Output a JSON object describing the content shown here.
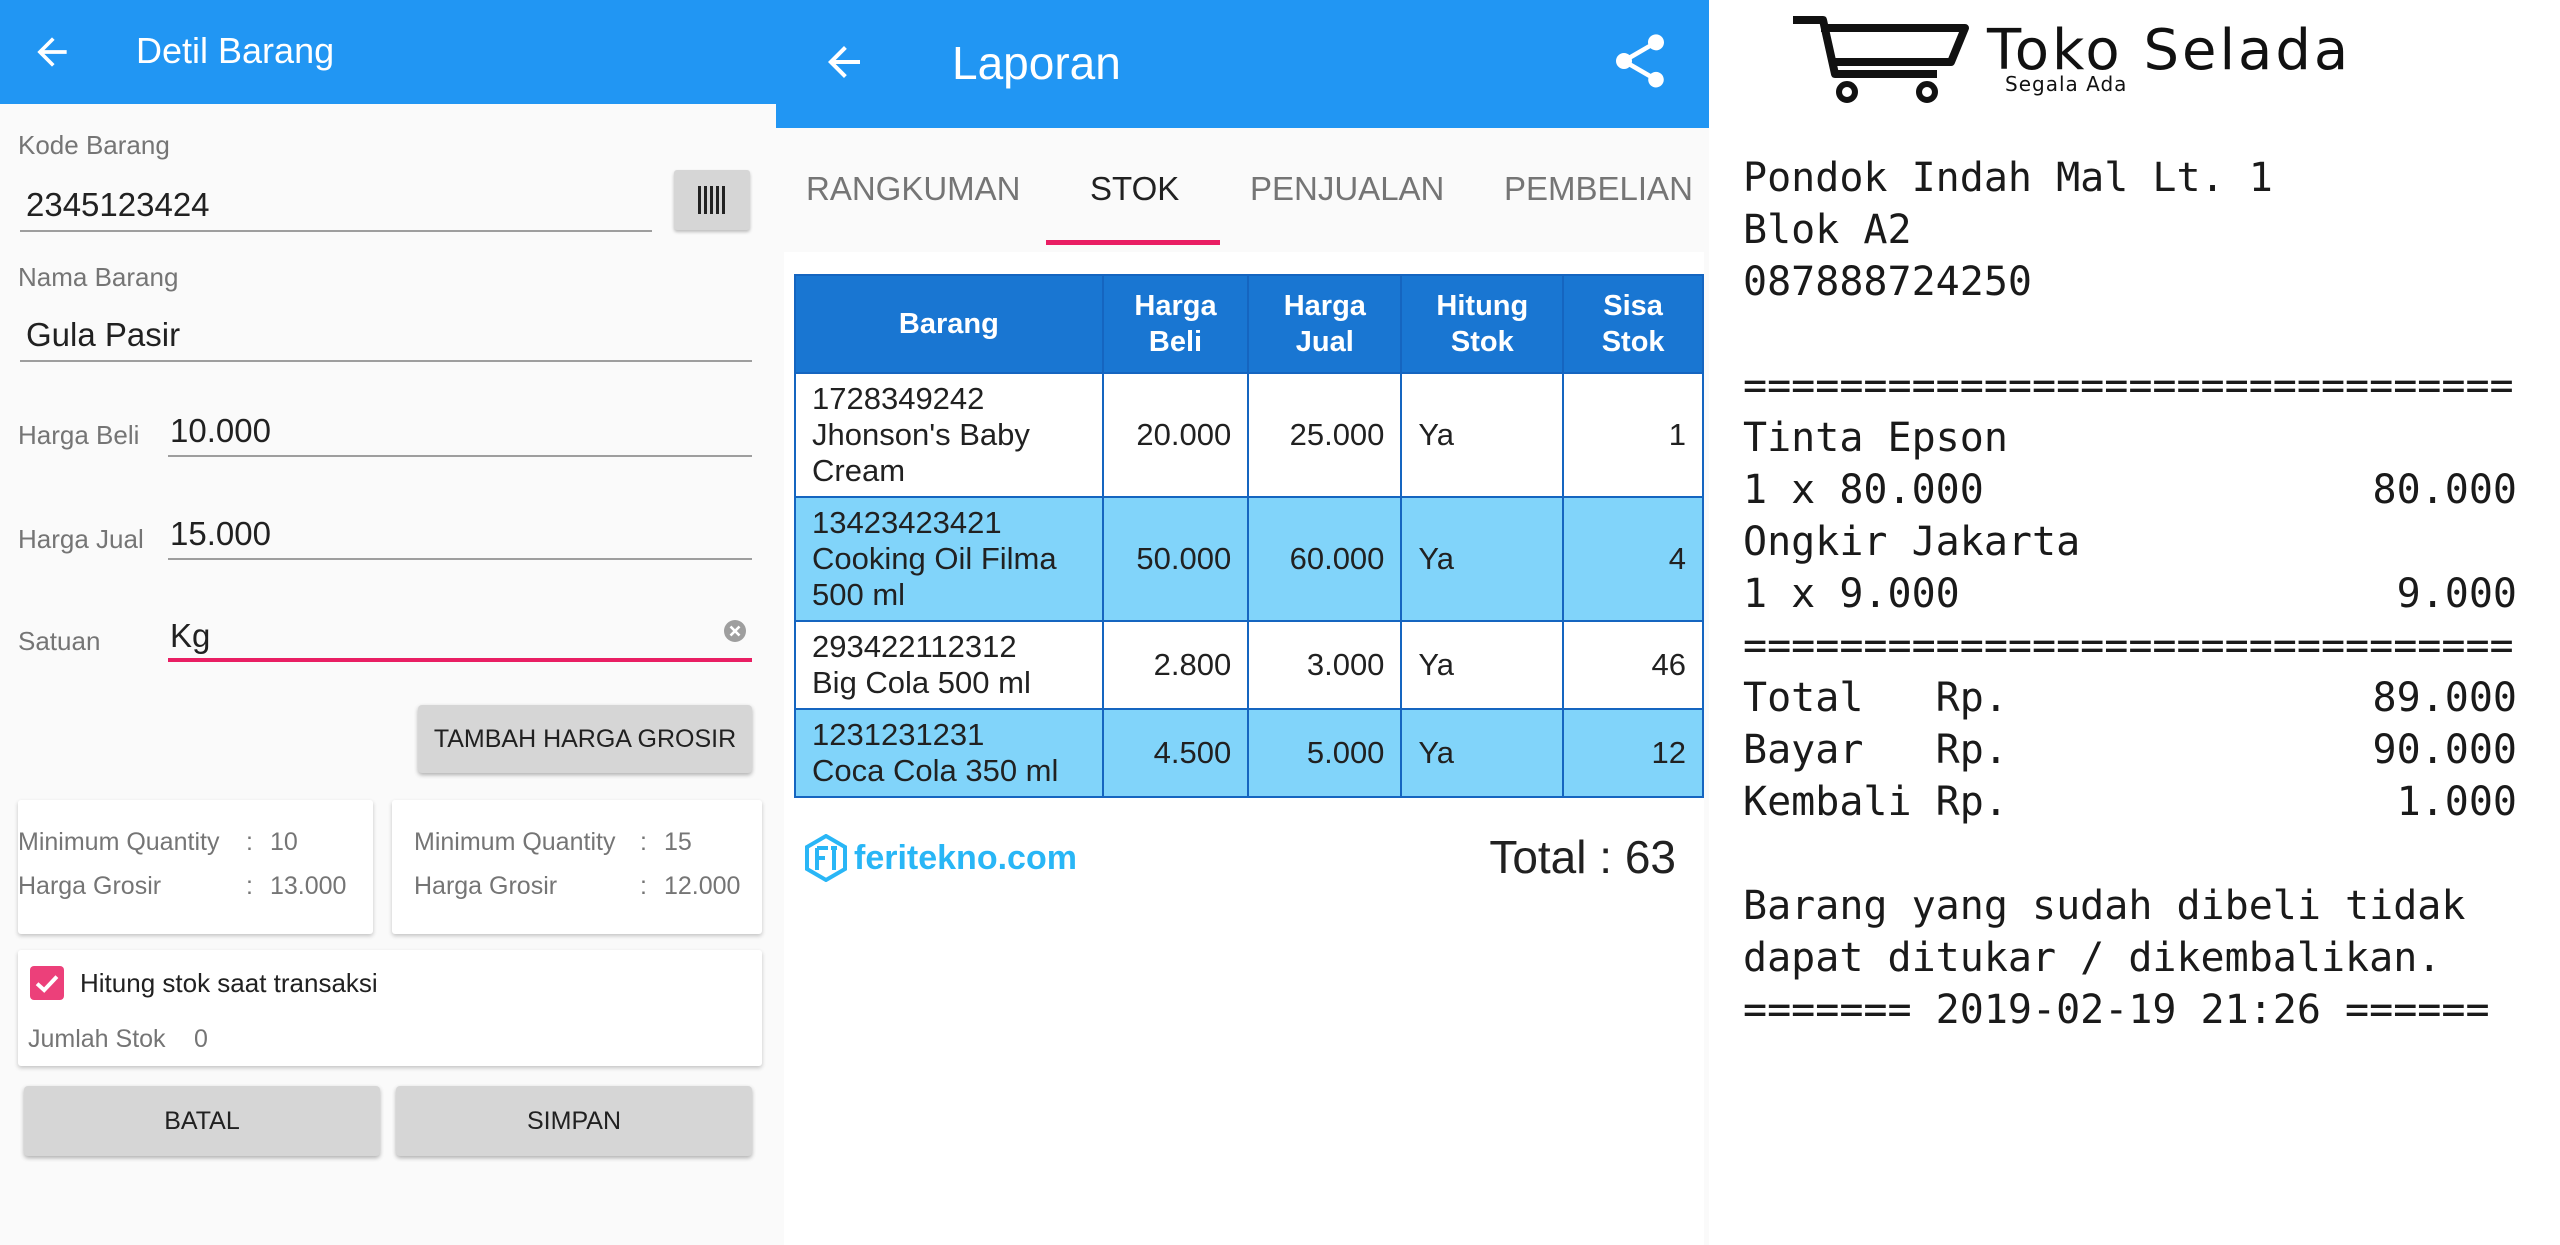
{
  "detil": {
    "title": "Detil Barang",
    "kode_label": "Kode Barang",
    "kode_value": "2345123424",
    "nama_label": "Nama Barang",
    "nama_value": "Gula Pasir",
    "harga_beli_label": "Harga Beli",
    "harga_beli_value": "10.000",
    "harga_jual_label": "Harga Jual",
    "harga_jual_value": "15.000",
    "satuan_label": "Satuan",
    "satuan_value": "Kg",
    "tambah_grosir_label": "TAMBAH HARGA GROSIR",
    "grosir": [
      {
        "min_qty_label": "Minimum Quantity",
        "min_qty": "10",
        "harga_label": "Harga Grosir",
        "harga": "13.000"
      },
      {
        "min_qty_label": "Minimum Quantity",
        "min_qty": "15",
        "harga_label": "Harga Grosir",
        "harga": "12.000"
      }
    ],
    "hitung_stok_label": "Hitung stok saat transaksi",
    "hitung_stok_checked": true,
    "jumlah_stok_label": "Jumlah Stok",
    "jumlah_stok_value": "0",
    "batal_label": "BATAL",
    "simpan_label": "SIMPAN"
  },
  "laporan": {
    "title": "Laporan",
    "tabs": [
      "RANGKUMAN",
      "STOK",
      "PENJUALAN",
      "PEMBELIAN"
    ],
    "active_tab": "STOK",
    "table": {
      "headers": [
        [
          "Barang"
        ],
        [
          "Harga",
          "Beli"
        ],
        [
          "Harga",
          "Jual"
        ],
        [
          "Hitung",
          "Stok"
        ],
        [
          "Sisa",
          "Stok"
        ]
      ],
      "rows": [
        {
          "barang": [
            "1728349242",
            "Jhonson's Baby",
            "Cream"
          ],
          "harga_beli": "20.000",
          "harga_jual": "25.000",
          "hitung": "Ya",
          "sisa": "1"
        },
        {
          "barang": [
            "13423423421",
            "Cooking Oil Filma",
            "500 ml"
          ],
          "harga_beli": "50.000",
          "harga_jual": "60.000",
          "hitung": "Ya",
          "sisa": "4"
        },
        {
          "barang": [
            "293422112312",
            "Big Cola 500 ml"
          ],
          "harga_beli": "2.800",
          "harga_jual": "3.000",
          "hitung": "Ya",
          "sisa": "46"
        },
        {
          "barang": [
            "1231231231",
            "Coca Cola 350 ml"
          ],
          "harga_beli": "4.500",
          "harga_jual": "5.000",
          "hitung": "Ya",
          "sisa": "12"
        }
      ]
    },
    "brand": "feritekno.com",
    "total": "Total : 63"
  },
  "receipt": {
    "store_name": "Toko Selada",
    "store_tagline": "Segala Ada",
    "lines": [
      {
        "left": "Pondok Indah Mal Lt. 1",
        "right": ""
      },
      {
        "left": "Blok A2",
        "right": ""
      },
      {
        "left": "087888724250",
        "right": ""
      },
      {
        "left": "",
        "right": ""
      },
      {
        "left": "================================",
        "right": ""
      },
      {
        "left": "Tinta Epson",
        "right": ""
      },
      {
        "left": "1 x 80.000",
        "right": "80.000"
      },
      {
        "left": "Ongkir Jakarta",
        "right": ""
      },
      {
        "left": "1 x 9.000",
        "right": "9.000"
      },
      {
        "left": "================================",
        "right": ""
      },
      {
        "left": "Total   Rp.",
        "right": "89.000"
      },
      {
        "left": "Bayar   Rp.",
        "right": "90.000"
      },
      {
        "left": "Kembali Rp.",
        "right": "1.000"
      },
      {
        "left": "",
        "right": ""
      },
      {
        "left": "Barang yang sudah dibeli tidak",
        "right": ""
      },
      {
        "left": "dapat ditukar / dikembalikan.",
        "right": ""
      },
      {
        "left": "======= 2019-02-19 21:26 ======",
        "right": ""
      }
    ]
  },
  "colors": {
    "primary": "#2196f3",
    "accent": "#e91e63",
    "table_header": "#1976d2",
    "table_alt_row": "#81d4fa",
    "brand": "#29b6f6"
  },
  "icons": [
    "arrow-back-icon",
    "barcode-icon",
    "clear-icon",
    "checkbox-icon",
    "share-icon",
    "feritekno-logo-icon",
    "shopping-cart-icon"
  ]
}
